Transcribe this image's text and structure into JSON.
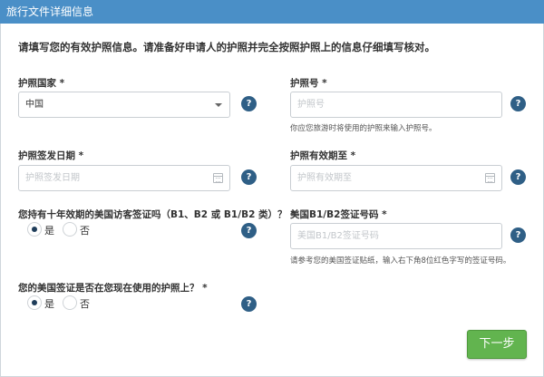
{
  "header": {
    "title": "旅行文件详细信息"
  },
  "intro": "请填写您的有效护照信息。请准备好申请人的护照并完全按照护照上的信息仔细填写核对。",
  "help_symbol": "?",
  "passport_country": {
    "label": "护照国家 *",
    "value": "中国"
  },
  "passport_number": {
    "label": "护照号 *",
    "placeholder": "护照号",
    "hint": "你应您旅游时将使用的护照来输入护照号。"
  },
  "issue_date": {
    "label": "护照签发日期 *",
    "placeholder": "护照签发日期"
  },
  "expiry_date": {
    "label": "护照有效期至 *",
    "placeholder": "护照有效期至"
  },
  "ten_year_visa": {
    "label": "您持有十年效期的美国访客签证吗（B1、B2 或 B1/B2 类）？ *",
    "options": [
      {
        "label": "是",
        "checked": true
      },
      {
        "label": "否",
        "checked": false
      }
    ]
  },
  "visa_number": {
    "label": "美国B1/B2签证号码 *",
    "placeholder": "美国B1/B2签证号码",
    "hint": "请参考您的美国签证贴纸，输入右下角8位红色字写的签证号码。"
  },
  "visa_in_passport": {
    "label": "您的美国签证是否在您现在使用的护照上？ *",
    "options": [
      {
        "label": "是",
        "checked": true
      },
      {
        "label": "否",
        "checked": false
      }
    ]
  },
  "next_button": {
    "label": "下一步"
  },
  "colors": {
    "header": "#4a8fc7",
    "help": "#2f5f86",
    "next": "#62b44f"
  }
}
